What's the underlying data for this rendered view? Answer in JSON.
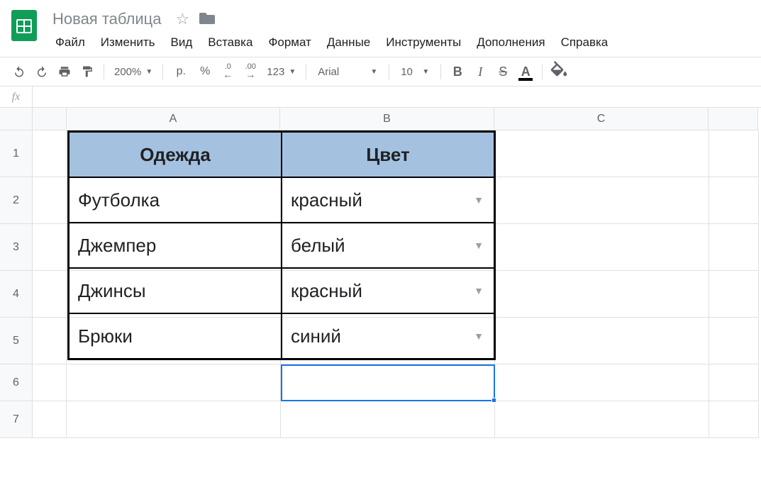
{
  "doc": {
    "title": "Новая таблица"
  },
  "menu": {
    "file": "Файл",
    "edit": "Изменить",
    "view": "Вид",
    "insert": "Вставка",
    "format": "Формат",
    "data": "Данные",
    "tools": "Инструменты",
    "addons": "Дополнения",
    "help": "Справка"
  },
  "toolbar": {
    "zoom": "200%",
    "currency": "р.",
    "percent": "%",
    "dec_dec": ".0",
    "dec_inc": ".00",
    "numfmt": "123",
    "font": "Arial",
    "fontsize": "10",
    "bold": "B",
    "italic": "I",
    "strike": "S",
    "textcolor": "A"
  },
  "formula_bar": {
    "fx": "fx",
    "value": ""
  },
  "columns": {
    "a": "A",
    "b": "B",
    "c": "C"
  },
  "rows": {
    "r1": "1",
    "r2": "2",
    "r3": "3",
    "r4": "4",
    "r5": "5",
    "r6": "6",
    "r7": "7"
  },
  "table": {
    "header": {
      "a": "Одежда",
      "b": "Цвет"
    },
    "data": [
      {
        "a": "Футболка",
        "b": "красный"
      },
      {
        "a": "Джемпер",
        "b": "белый"
      },
      {
        "a": "Джинсы",
        "b": "красный"
      },
      {
        "a": "Брюки",
        "b": "синий"
      }
    ]
  }
}
